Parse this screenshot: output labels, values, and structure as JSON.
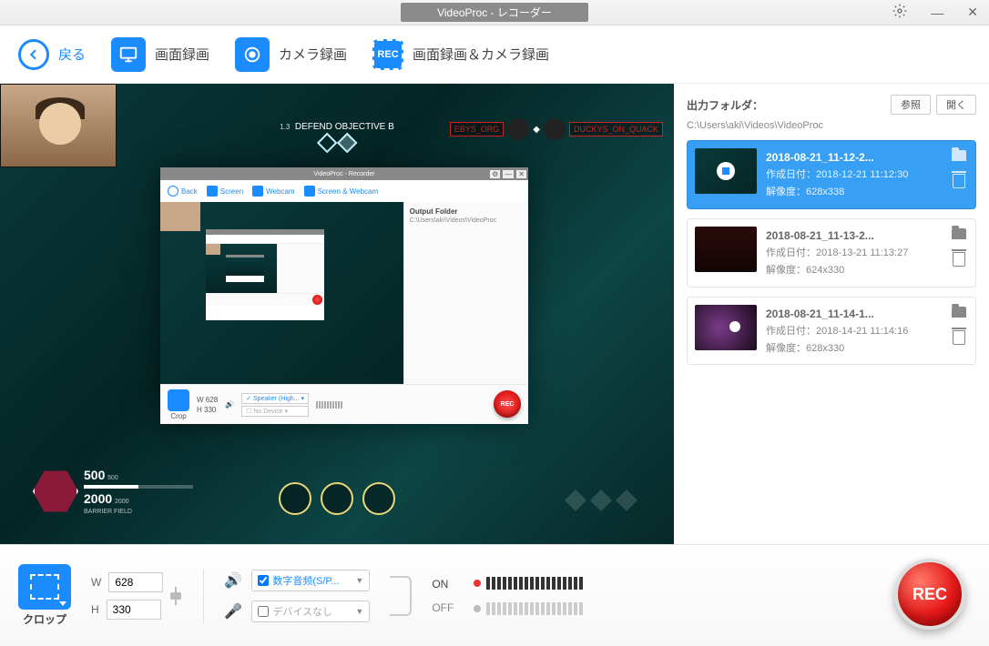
{
  "title": "VideoProc - レコーダー",
  "toolbar": {
    "back": "戻る",
    "screen": "画面録画",
    "camera": "カメラ録画",
    "both": "画面録画＆カメラ録画",
    "rec_icon_label": "REC"
  },
  "preview": {
    "hud_sub": "1.3",
    "hud_title": "DEFEND OBJECTIVE B",
    "hud_name1": "EBYS_ORG",
    "hud_name2": "DUCKYS_ON_QUACK",
    "hp1": "500",
    "hp1_max": "500",
    "hp2": "2000",
    "hp2_max": "2000",
    "hero_lbl": "BARRIER FIELD",
    "inner": {
      "title": "VideoProc - Recorder",
      "back": "Back",
      "screen": "Screen",
      "webcam": "Webcam",
      "both": "Screen & Webcam",
      "side_lbl": "Output Folder",
      "side_path": "C:\\Users\\aki\\Videos\\VideoProc",
      "crop": "Crop",
      "wlbl": "W",
      "wv": "628",
      "hlbl": "H",
      "hv": "330",
      "aud1": "Speaker (High...",
      "aud2": "No Device",
      "rec": "REC"
    }
  },
  "side": {
    "label": "出力フォルダ：",
    "browse": "参照",
    "open": "開く",
    "path": "C:\\Users\\aki\\Videos\\VideoProc",
    "items": [
      {
        "name": "2018-08-21_11-12-2...",
        "date": "作成日付：2018-12-21 11:12:30",
        "res": "解像度：628x338"
      },
      {
        "name": "2018-08-21_11-13-2...",
        "date": "作成日付：2018-13-21 11:13:27",
        "res": "解像度：624x330"
      },
      {
        "name": "2018-08-21_11-14-1...",
        "date": "作成日付：2018-14-21 11:14:16",
        "res": "解像度：628x330"
      }
    ]
  },
  "footer": {
    "crop": "クロップ",
    "wlbl": "W",
    "wv": "628",
    "hlbl": "H",
    "hv": "330",
    "aud1": "数字音频(S/P...",
    "aud2": "デバイスなし",
    "on": "ON",
    "off": "OFF",
    "rec": "REC"
  }
}
